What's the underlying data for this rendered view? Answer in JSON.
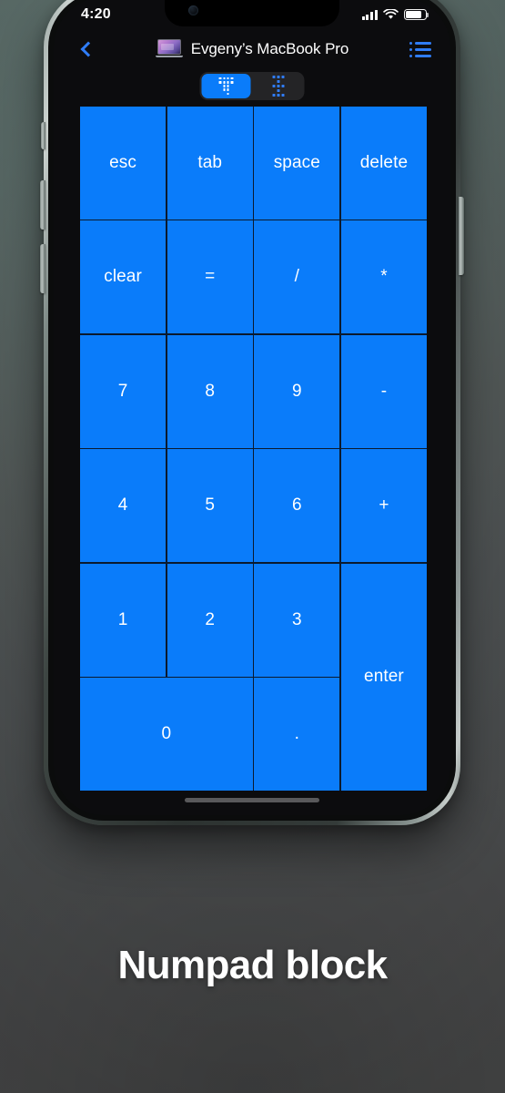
{
  "status_bar": {
    "time": "4:20",
    "signal_icon": "cellular-signal-icon",
    "wifi_icon": "wifi-icon",
    "battery_icon": "battery-icon"
  },
  "nav_bar": {
    "back_icon": "chevron-left-icon",
    "device_thumbnail_icon": "macbook-thumbnail-icon",
    "title": "Evgeny’s MacBook Pro",
    "list_icon": "list-bullet-icon"
  },
  "segmented_control": {
    "segments": [
      {
        "name": "numpad-mode",
        "icon": "numpad-dots-icon",
        "active": true
      },
      {
        "name": "grid-mode",
        "icon": "grid-dots-icon",
        "active": false
      }
    ]
  },
  "keypad": {
    "keys": [
      {
        "label": "esc",
        "name": "key-esc"
      },
      {
        "label": "tab",
        "name": "key-tab"
      },
      {
        "label": "space",
        "name": "key-space"
      },
      {
        "label": "delete",
        "name": "key-delete"
      },
      {
        "label": "clear",
        "name": "key-clear"
      },
      {
        "label": "=",
        "name": "key-equals"
      },
      {
        "label": "/",
        "name": "key-divide"
      },
      {
        "label": "*",
        "name": "key-multiply"
      },
      {
        "label": "7",
        "name": "key-7"
      },
      {
        "label": "8",
        "name": "key-8"
      },
      {
        "label": "9",
        "name": "key-9"
      },
      {
        "label": "-",
        "name": "key-minus"
      },
      {
        "label": "4",
        "name": "key-4"
      },
      {
        "label": "5",
        "name": "key-5"
      },
      {
        "label": "6",
        "name": "key-6"
      },
      {
        "label": "+",
        "name": "key-plus"
      },
      {
        "label": "1",
        "name": "key-1"
      },
      {
        "label": "2",
        "name": "key-2"
      },
      {
        "label": "3",
        "name": "key-3"
      },
      {
        "label": "enter",
        "name": "key-enter"
      },
      {
        "label": "0",
        "name": "key-0"
      },
      {
        "label": ".",
        "name": "key-decimal"
      }
    ]
  },
  "caption": {
    "text": "Numpad block"
  },
  "colors": {
    "key_blue": "#0a7cfa",
    "accent_blue": "#2f7cf6",
    "screen_background": "#0c0c0e",
    "key_border": "#0b1a2e",
    "caption_text": "#ffffff"
  }
}
